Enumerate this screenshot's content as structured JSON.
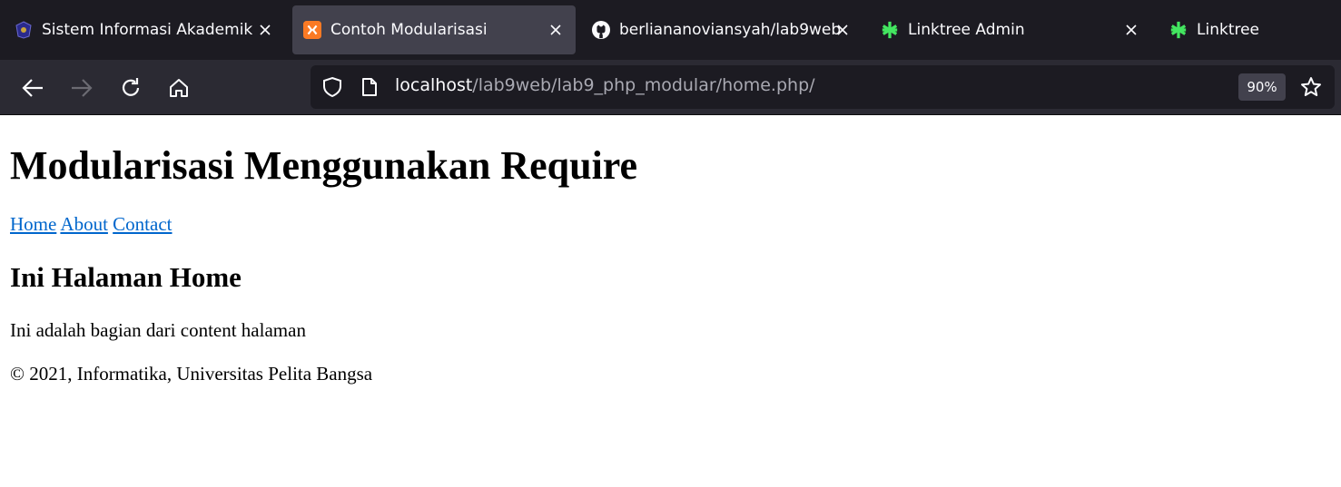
{
  "browser": {
    "tabs": [
      {
        "title": "Sistem Informasi Akademik",
        "icon": "university-logo-icon"
      },
      {
        "title": "Contoh Modularisasi",
        "icon": "xampp-icon",
        "active": true
      },
      {
        "title": "berliananoviansyah/lab9web",
        "icon": "github-icon"
      },
      {
        "title": "Linktree Admin",
        "icon": "linktree-icon"
      },
      {
        "title": "Linktree",
        "icon": "linktree-icon"
      }
    ],
    "url_host": "localhost",
    "url_path": "/lab9web/lab9_php_modular/home.php/",
    "zoom": "90%",
    "colors": {
      "tabbar": "#1c1b22",
      "active_tab": "#42414d",
      "toolbar": "#2b2a33",
      "link": "#0066cc",
      "xampp": "#fb7a24",
      "linktree": "#43e660"
    }
  },
  "page": {
    "heading": "Modularisasi Menggunakan Require",
    "nav": [
      "Home",
      "About",
      "Contact"
    ],
    "section_title": "Ini Halaman Home",
    "content_text": "Ini adalah bagian dari content halaman",
    "footer": "© 2021, Informatika, Universitas Pelita Bangsa"
  }
}
